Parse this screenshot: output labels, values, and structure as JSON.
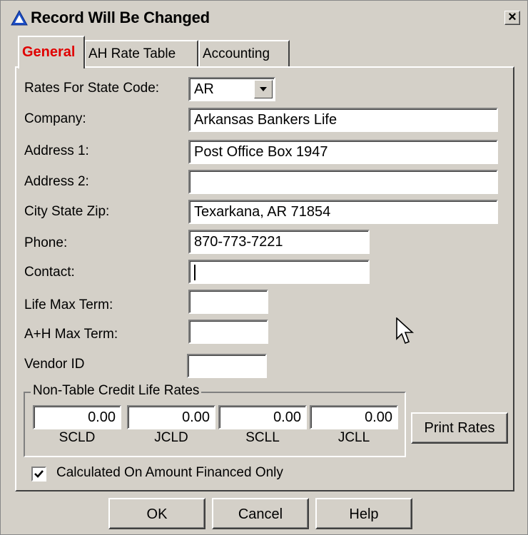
{
  "window": {
    "title": "Record Will Be Changed"
  },
  "tabs": [
    {
      "label": "General"
    },
    {
      "label": "AH Rate Table"
    },
    {
      "label": "Accounting"
    }
  ],
  "form": {
    "state_code": {
      "label": "Rates For State Code:",
      "value": "AR"
    },
    "company": {
      "label": "Company:",
      "value": "Arkansas Bankers Life"
    },
    "address1": {
      "label": "Address 1:",
      "value": "Post Office Box 1947"
    },
    "address2": {
      "label": "Address 2:",
      "value": ""
    },
    "city_state_zip": {
      "label": "City State Zip:",
      "value": "Texarkana, AR 71854"
    },
    "phone": {
      "label": "Phone:",
      "value": "870-773-7221"
    },
    "contact": {
      "label": "Contact:",
      "value": ""
    },
    "life_max_term": {
      "label": "Life Max Term:",
      "value": ""
    },
    "ah_max_term": {
      "label": "A+H Max Term:",
      "value": ""
    },
    "vendor_id": {
      "label": "Vendor ID",
      "value": ""
    }
  },
  "credit_life": {
    "title": "Non-Table Credit Life Rates",
    "rates": [
      {
        "label": "SCLD",
        "value": "0.00"
      },
      {
        "label": "JCLD",
        "value": "0.00"
      },
      {
        "label": "SCLL",
        "value": "0.00"
      },
      {
        "label": "JCLL",
        "value": "0.00"
      }
    ],
    "print_button": "Print Rates"
  },
  "calculated_checkbox": {
    "label": "Calculated On Amount Financed Only",
    "checked": true
  },
  "buttons": {
    "ok": "OK",
    "cancel": "Cancel",
    "help": "Help"
  },
  "colors": {
    "dialog_bg": "#d4d0c8",
    "active_tab_text": "#e00000"
  },
  "icons": {
    "title": "app-triangle-icon",
    "close": "close-icon",
    "dropdown": "dropdown-arrow-icon",
    "check": "checkmark-icon",
    "cursor": "mouse-pointer-icon"
  }
}
